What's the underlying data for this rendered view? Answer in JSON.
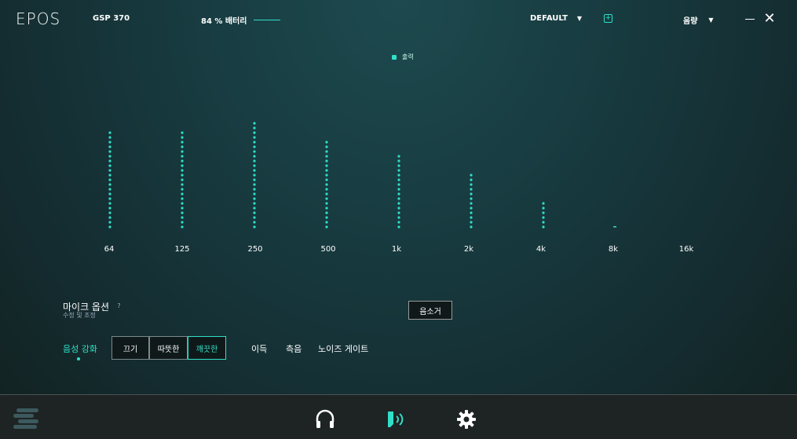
{
  "header": {
    "logo": "EPOS",
    "device": "GSP 370",
    "battery": "84 % 배터리",
    "preset": "DEFAULT",
    "volume": "음량"
  },
  "legend": {
    "label": "출력"
  },
  "chart_data": {
    "type": "bar",
    "categories": [
      "64",
      "125",
      "250",
      "500",
      "1k",
      "2k",
      "4k",
      "8k",
      "16k"
    ],
    "series": [
      {
        "values": [
          20,
          20,
          22.5,
          18.5,
          15,
          11.5,
          5.5,
          0.2,
          0
        ]
      }
    ],
    "ylim": [
      0,
      23
    ],
    "grid": false
  },
  "mic": {
    "title": "마이크 옵션",
    "help": "?",
    "subtitle": "수정 및 조정",
    "mute": "음소거",
    "enhance_label": "음성 강화",
    "modes": [
      "끄기",
      "따뜻한",
      "깨끗한"
    ],
    "active_mode": "깨끗한",
    "options": [
      "이득",
      "측음",
      "노이즈 게이트"
    ]
  },
  "colors": {
    "accent": "#2fe0c8",
    "bottom_bar": "#1e2324"
  },
  "icons": [
    "menu-icon",
    "headset-icon",
    "microphone-icon",
    "gear-icon",
    "add-icon",
    "close-icon",
    "minimize-icon"
  ]
}
